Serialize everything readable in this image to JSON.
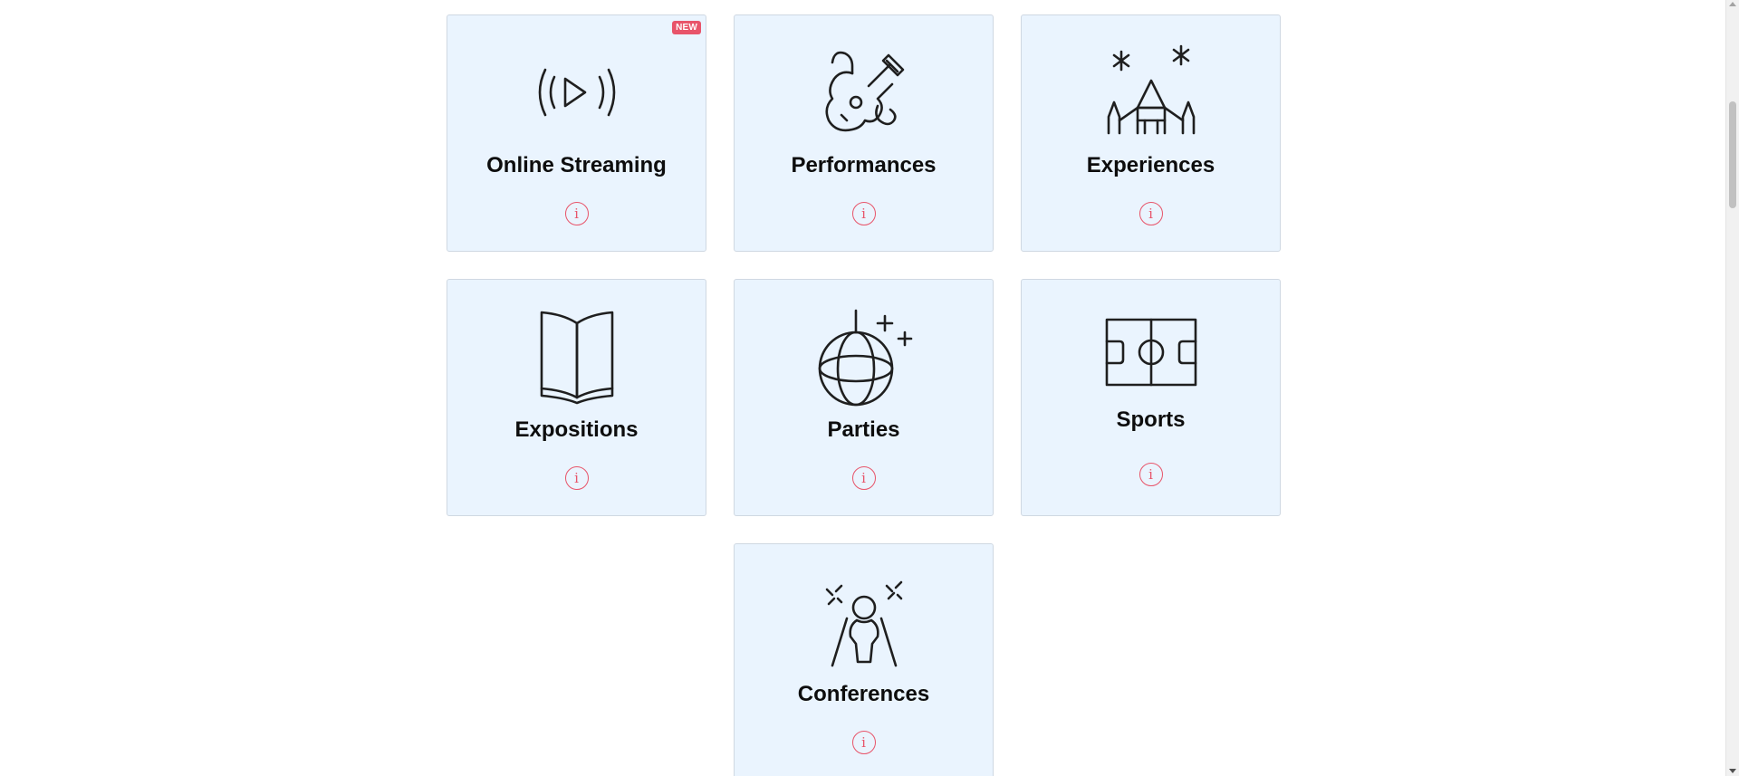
{
  "categories": [
    {
      "title": "Online Streaming",
      "icon": "streaming-play-icon",
      "badge": "NEW",
      "info_glyph": "i"
    },
    {
      "title": "Performances",
      "icon": "guitar-icon",
      "info_glyph": "i"
    },
    {
      "title": "Experiences",
      "icon": "castle-fireworks-icon",
      "info_glyph": "i"
    },
    {
      "title": "Expositions",
      "icon": "open-book-icon",
      "info_glyph": "i"
    },
    {
      "title": "Parties",
      "icon": "disco-ball-icon",
      "info_glyph": "i"
    },
    {
      "title": "Sports",
      "icon": "sports-field-icon",
      "info_glyph": "i"
    },
    {
      "title": "Conferences",
      "icon": "speaker-spotlight-icon",
      "info_glyph": "i"
    }
  ],
  "colors": {
    "card_background": "#eaf4fe",
    "accent": "#e8546a",
    "title_text": "#0d0d0d"
  }
}
